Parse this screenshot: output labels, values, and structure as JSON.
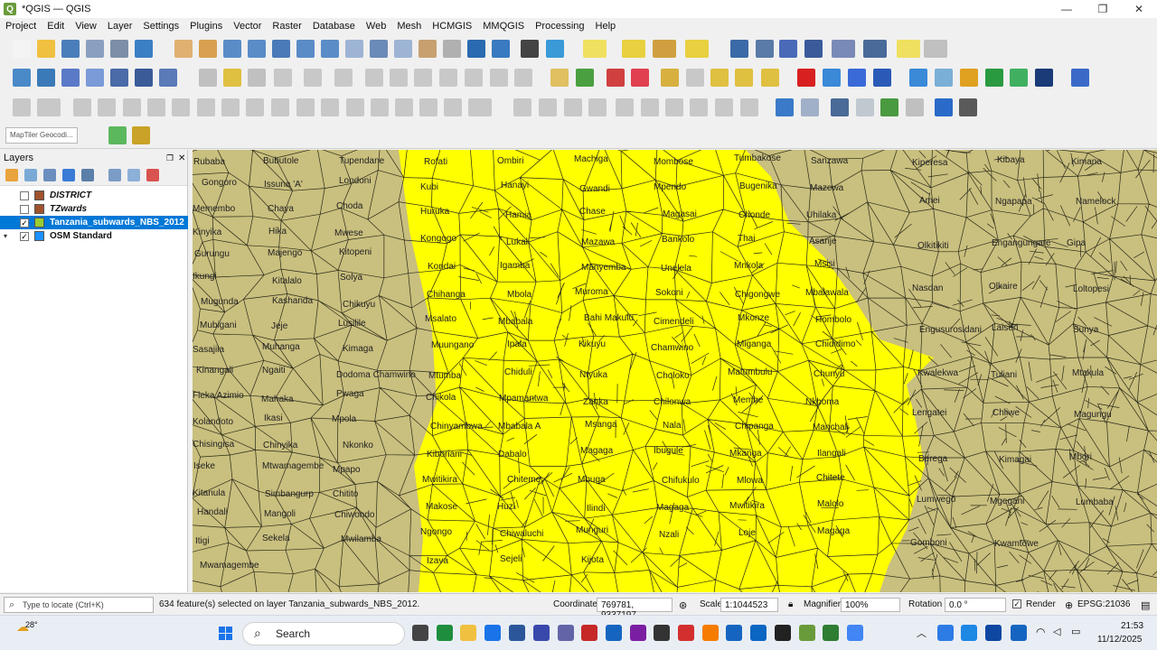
{
  "window": {
    "title": "*QGIS — QGIS",
    "minimize": "—",
    "maximize": "❐",
    "close": "✕"
  },
  "menu": [
    "Project",
    "Edit",
    "View",
    "Layer",
    "Settings",
    "Plugins",
    "Vector",
    "Raster",
    "Database",
    "Web",
    "Mesh",
    "HCMGIS",
    "MMQGIS",
    "Processing",
    "Help"
  ],
  "locator_row": {
    "geocoder_placeholder": "MapTiler Geocodi..."
  },
  "layers_panel": {
    "title": "Layers",
    "layers": [
      {
        "name": "DISTRICT",
        "checked": false,
        "selected": false,
        "italic": true,
        "symbol_color": "#a0522d",
        "expandable": false
      },
      {
        "name": "TZwards",
        "checked": false,
        "selected": false,
        "italic": true,
        "symbol_color": "#a0522d",
        "expandable": false
      },
      {
        "name": "Tanzania_subwards_NBS_2012",
        "checked": true,
        "selected": true,
        "italic": false,
        "symbol_color": "#9acd32",
        "expandable": false
      },
      {
        "name": "OSM Standard",
        "checked": true,
        "selected": false,
        "italic": false,
        "symbol_color": "#1e90ff",
        "expandable": true
      }
    ]
  },
  "map": {
    "background_color": "#c9bf7e",
    "selection_color": "#ffff00",
    "labels": {
      "left": [
        "Rubaba",
        "Bubutole",
        "Tupendane",
        "Gongoro",
        "Issuna 'A'",
        "Londoni",
        "Memembo",
        "Chaya",
        "Choda",
        "Kinyika",
        "Hika",
        "Mwese",
        "Gurungu",
        "Majengo",
        "Kitopeni",
        "Ikungi",
        "Kitalalo",
        "Solya",
        "Mugunda",
        "Kashanda",
        "Chikuyu",
        "Mubigani",
        "Jeje",
        "Lusilile",
        "Sasajila",
        "Muhanga",
        "Kimaga",
        "Kinangali",
        "Ngaiti",
        "Dodoma Chamwino",
        "Fleka Azimio",
        "Mahaka",
        "Pwaga",
        "Kolandoto",
        "Ikasi",
        "Mpola",
        "Chisingisa",
        "Chinyika",
        "Nkonko",
        "Iseke",
        "Mtwamagembe",
        "Mpapo",
        "Kitanula",
        "Simbangurp",
        "Chitito",
        "Handali",
        "Mangoli",
        "Chiwondo",
        "Itigi",
        "Sekela",
        "Mwilamba",
        "Mwamagembe"
      ],
      "center": [
        "Rofati",
        "Ombiri",
        "Machiga",
        "Mombose",
        "Tumbakose",
        "Sanzawa",
        "Kubi",
        "Hanayi",
        "Gwandi",
        "Mpendo",
        "Bugenika",
        "Mazewa",
        "Huruka",
        "Hamia",
        "Chase",
        "Magasai",
        "Chonde",
        "Uhilaka",
        "Kongogo",
        "Lukali",
        "Mazawa",
        "Bankolo",
        "Thai",
        "Asanje",
        "Kondai",
        "Igamba",
        "Manyemba",
        "Unelela",
        "Mnkola",
        "Msisi",
        "Chihanga",
        "Mbola",
        "Muroma",
        "Sokoni",
        "Chigongwe",
        "Mbalawala",
        "Msalato",
        "Mbabala",
        "Bahi Makulu",
        "Cimendeli",
        "Mkonze",
        "Hombolo",
        "Muungano",
        "Ipala",
        "Kikuyu",
        "Chamwino",
        "Miganga",
        "Chididimo",
        "Mtumba",
        "Chiduli",
        "Ntyuka",
        "Choloko",
        "Matumbulu",
        "Chunyu",
        "Chikola",
        "Mpamantwa",
        "Zanka",
        "Chilonwa",
        "Membe",
        "Nkhoma",
        "Chinyambwa",
        "Mbabala A",
        "Msanga",
        "Nala",
        "Chipanga",
        "Manchali",
        "Kiboriani",
        "Dabalo",
        "Magaga",
        "Ibugule",
        "Mkanga",
        "Ilangali",
        "Mwitikira",
        "Chiteme",
        "Mbuga",
        "Chifukulo",
        "Mlowa",
        "Chitete",
        "Makose",
        "Huzi",
        "Ilindi",
        "Magaga",
        "Mwitikira",
        "Malolo",
        "Ngongo",
        "Chiwaluchi",
        "Munguri",
        "Nzali",
        "Loje",
        "Magaga",
        "Izava",
        "Sejeli",
        "Kijota"
      ],
      "right": [
        "Kiperesa",
        "Kibaya",
        "Kimana",
        "Amei",
        "Ngapapa",
        "Namelock",
        "Olkitikiti",
        "Engangungare",
        "Gipa",
        "Nasdan",
        "Olkaire",
        "Loltopesi",
        "Engusurosidani",
        "Laiseri",
        "Sunya",
        "Kwalekwa",
        "Tuliani",
        "Mtakula",
        "Lengatei",
        "Chiiwe",
        "Magungu",
        "Berega",
        "Kimagai",
        "Mbori",
        "Lumwego",
        "Mgegani",
        "Lumbaba",
        "Gomboni",
        "Kwamtowe"
      ]
    }
  },
  "statusbar": {
    "locate_placeholder": "Type to locate (Ctrl+K)",
    "message": "634 feature(s) selected on layer Tanzania_subwards_NBS_2012.",
    "coordinate_label": "Coordinate",
    "coordinate_value": "769781, 9337197",
    "scale_label": "Scale",
    "scale_value": "1:1044523",
    "magnifier_label": "Magnifier",
    "magnifier_value": "100%",
    "rotation_label": "Rotation",
    "rotation_value": "0.0 °",
    "render_label": "Render",
    "render_checked": true,
    "crs": "EPSG:21036"
  },
  "taskbar": {
    "weather": "28°",
    "search_placeholder": "Search",
    "time": "21:53",
    "date": "11/12/2025"
  }
}
